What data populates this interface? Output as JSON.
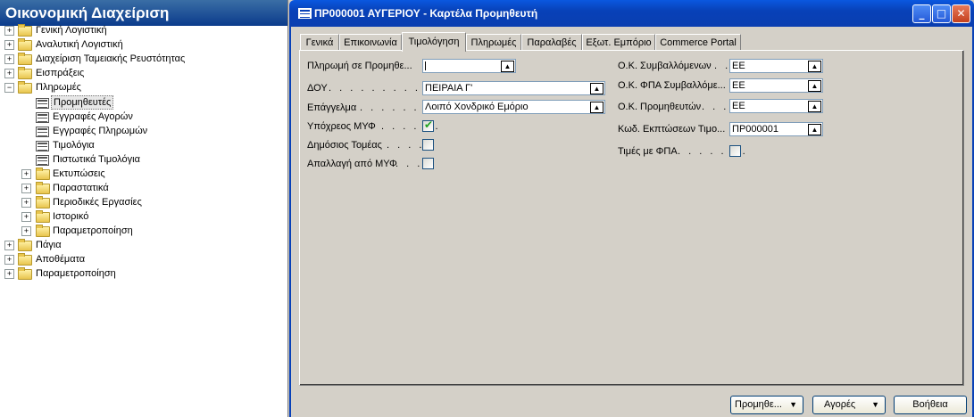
{
  "nav": {
    "title": "Οικονομική Διαχείριση",
    "items": [
      {
        "label": "Γενική Λογιστική",
        "expander": "+"
      },
      {
        "label": "Αναλυτική Λογιστική",
        "expander": "+"
      },
      {
        "label": "Διαχείριση Ταμειακής Ρευστότητας",
        "expander": "+"
      },
      {
        "label": "Εισπράξεις",
        "expander": "+"
      },
      {
        "label": "Πληρωμές",
        "expander": "−"
      },
      {
        "label": "Προμηθευτές"
      },
      {
        "label": "Εγγραφές Αγορών"
      },
      {
        "label": "Εγγραφές Πληρωμών"
      },
      {
        "label": "Τιμολόγια"
      },
      {
        "label": "Πιστωτικά Τιμολόγια"
      },
      {
        "label": "Εκτυπώσεις",
        "expander": "+"
      },
      {
        "label": "Παραστατικά",
        "expander": "+"
      },
      {
        "label": "Περιοδικές Εργασίες",
        "expander": "+"
      },
      {
        "label": "Ιστορικό",
        "expander": "+"
      },
      {
        "label": "Παραμετροποίηση",
        "expander": "+"
      },
      {
        "label": "Πάγια",
        "expander": "+"
      },
      {
        "label": "Αποθέματα",
        "expander": "+"
      },
      {
        "label": "Παραμετροποίηση",
        "expander": "+"
      }
    ]
  },
  "window": {
    "title": "ΠΡ000001 ΑΥΓΕΡΙΟΥ - Καρτέλα Προμηθευτή",
    "minimize": "_",
    "maximize": "□",
    "close": "✕"
  },
  "tabs": [
    "Γενικά",
    "Επικοινωνία",
    "Τιμολόγηση",
    "Πληρωμές",
    "Παραλαβές",
    "Εξωτ. Εμπόριο",
    "Commerce Portal"
  ],
  "active_tab": "Τιμολόγηση",
  "form": {
    "left": [
      {
        "label": "Πληρωμή σε Προμηθε...",
        "dots": "",
        "value": ""
      },
      {
        "label": "ΔΟΥ",
        "dots": ". . . . . . . . . . .",
        "value": "ΠΕΙΡΑΙΑ Γ'"
      },
      {
        "label": "Επάγγελμα",
        "dots": ". . . . . . .",
        "value": "Λοιπό Χονδρικό Εμόριο"
      },
      {
        "label": "Υπόχρεος ΜΥΦ",
        "dots": ". . . . . .",
        "checked": true
      },
      {
        "label": "Δημόσιος Τομέας",
        "dots": ". . . .",
        "checked": false
      },
      {
        "label": "Απαλλαγή από ΜΥΦ",
        "dots": ". . .",
        "checked": false
      }
    ],
    "right": [
      {
        "label": "Ο.Κ. Συμβαλλόμενων",
        "dots": ". .",
        "value": "ΕΕ"
      },
      {
        "label": "Ο.Κ. ΦΠΑ Συμβαλλόμε...",
        "dots": "",
        "value": "ΕΕ"
      },
      {
        "label": "Ο.Κ. Προμηθευτών",
        "dots": ". . .",
        "value": "ΕΕ"
      },
      {
        "label": "Κωδ. Εκπτώσεων Τιμο...",
        "dots": "",
        "value": "ΠΡ000001"
      },
      {
        "label": "Τιμές με ΦΠΑ",
        "dots": ". . . . . . .",
        "checked": false
      }
    ]
  },
  "buttons": {
    "suppliers": "Προμηθε...",
    "purchases": "Αγορές",
    "help": "Βοήθεια",
    "dropdown_glyph": "▼"
  },
  "icons": {
    "lookup": "lookup-arrow-icon",
    "check": "✔"
  }
}
